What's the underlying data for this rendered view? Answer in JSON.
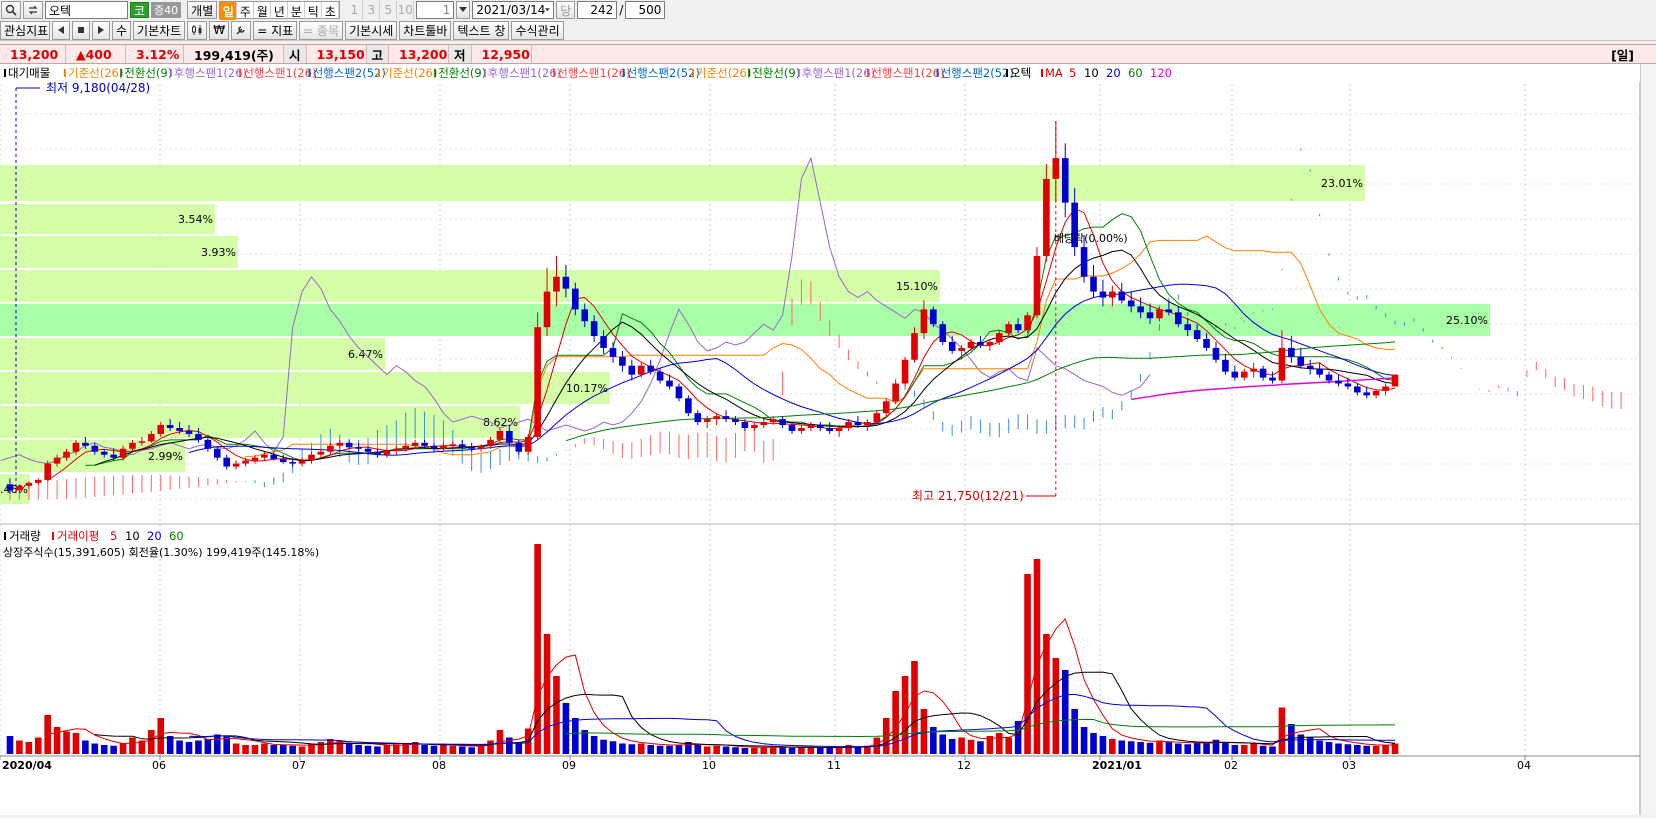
{
  "toolbar": {
    "stock_name": "오텍",
    "market_badge": "코",
    "margin_badge": "증40",
    "individual_label": "개별",
    "periods": [
      "일",
      "주",
      "월",
      "년",
      "분",
      "틱",
      "초"
    ],
    "active_period": "일",
    "interval_buttons": [
      "1",
      "3",
      "5",
      "10"
    ],
    "interval_value": "1",
    "date_value": "2021/03/14",
    "dang_label": "당",
    "count_value": "242",
    "slash": "/",
    "total_value": "500"
  },
  "toolbar2": {
    "watch_indicators": "관심지표",
    "basic_chart": "기본차트",
    "indicator": "= 지표",
    "stock_item": "= 종목",
    "basic_quote": "기본시세",
    "chart_toolbar": "차트툴바",
    "text_window": "텍스트 창",
    "formula_mgmt": "수식관리",
    "su": "수",
    "won_symbol": "₩"
  },
  "priceline": {
    "current": "13,200",
    "change": "▲400",
    "change_pct": "3.12%",
    "volume": "199,419(주)",
    "open_label": "시",
    "open": "13,150",
    "high_label": "고",
    "high": "13,200",
    "low_label": "저",
    "low": "12,950",
    "period_label": "[일]"
  },
  "legend": {
    "items": [
      {
        "text": "대기매물",
        "color": "#000000"
      },
      {
        "text": "기준선(26)",
        "color": "#ff8000"
      },
      {
        "text": "전환선(9)",
        "color": "#008000"
      },
      {
        "text": "후행스팬1(26)",
        "color": "#9966cc"
      },
      {
        "text": "선행스팬1(26)",
        "color": "#ff4040"
      },
      {
        "text": "선행스팬2(52)",
        "color": "#0066cc"
      },
      {
        "text": "기준선(26)",
        "color": "#ff8000"
      },
      {
        "text": "전환선(9)",
        "color": "#008000"
      },
      {
        "text": "후행스팬1(26)",
        "color": "#9966cc"
      },
      {
        "text": "선행스팬1(26)",
        "color": "#ff4040"
      },
      {
        "text": "선행스팬2(52)",
        "color": "#0066cc"
      },
      {
        "text": "기준선(26)",
        "color": "#ff8000"
      },
      {
        "text": "전환선(9)",
        "color": "#008000"
      },
      {
        "text": "후행스팬1(26)",
        "color": "#9966cc"
      },
      {
        "text": "선행스팬1(26)",
        "color": "#ff4040"
      },
      {
        "text": "선행스팬2(52)",
        "color": "#0066cc"
      },
      {
        "text": "오텍",
        "color": "#000000"
      }
    ],
    "ma_label": "MA",
    "ma_periods": [
      {
        "text": "5",
        "color": "#e00000"
      },
      {
        "text": "10",
        "color": "#000000"
      },
      {
        "text": "20",
        "color": "#0000e0"
      },
      {
        "text": "60",
        "color": "#008000"
      },
      {
        "text": "120",
        "color": "#e000e0"
      }
    ]
  },
  "volume_legend": {
    "title": "거래량",
    "ma_label": "거래이평",
    "periods": [
      {
        "text": "5",
        "color": "#e00000"
      },
      {
        "text": "10",
        "color": "#000000"
      },
      {
        "text": "20",
        "color": "#0000e0"
      },
      {
        "text": "60",
        "color": "#008000"
      }
    ],
    "shares_info": "상장주식수(15,391,605) 회전율(1.30%) 199,419주(145.18%)"
  },
  "chart_data": {
    "type": "candlestick",
    "x_tick_labels": [
      "2020/04",
      "06",
      "07",
      "08",
      "09",
      "10",
      "11",
      "12",
      "2021/01",
      "02",
      "03",
      "04"
    ],
    "annotations": {
      "low": "최저 9,180(04/28)",
      "high": "최고 21,750(12/21)",
      "ex_dividend": "배당락(0.00%)"
    },
    "supply_zones": [
      {
        "pct": "23.01%"
      },
      {
        "pct": "3.54%"
      },
      {
        "pct": "3.93%"
      },
      {
        "pct": "15.10%"
      },
      {
        "pct": "25.10%"
      },
      {
        "pct": "6.47%"
      },
      {
        "pct": "10.17%"
      },
      {
        "pct": "8.62%"
      },
      {
        "pct": "2.99%"
      },
      {
        "pct": "0.46%"
      }
    ],
    "candles": [
      [
        9500,
        9700,
        9180,
        9300
      ],
      [
        9300,
        9500,
        9200,
        9450
      ],
      [
        9450,
        9600,
        9350,
        9550
      ],
      [
        9550,
        9700,
        9500,
        9650
      ],
      [
        9650,
        10300,
        9600,
        10200
      ],
      [
        10200,
        10500,
        10100,
        10400
      ],
      [
        10400,
        10700,
        10300,
        10600
      ],
      [
        10600,
        11000,
        10500,
        10900
      ],
      [
        10900,
        11100,
        10700,
        10800
      ],
      [
        10800,
        10900,
        10500,
        10600
      ],
      [
        10600,
        10700,
        10400,
        10500
      ],
      [
        10500,
        10700,
        10300,
        10400
      ],
      [
        10400,
        10800,
        10300,
        10700
      ],
      [
        10700,
        11000,
        10600,
        10900
      ],
      [
        10900,
        11100,
        10800,
        10950
      ],
      [
        10950,
        11300,
        10900,
        11200
      ],
      [
        11200,
        11600,
        11100,
        11500
      ],
      [
        11500,
        11700,
        11300,
        11400
      ],
      [
        11400,
        11600,
        11200,
        11300
      ],
      [
        11300,
        11500,
        11100,
        11200
      ],
      [
        11200,
        11400,
        10900,
        11000
      ],
      [
        11000,
        11100,
        10600,
        10700
      ],
      [
        10700,
        10800,
        10300,
        10400
      ],
      [
        10400,
        10500,
        10000,
        10100
      ],
      [
        10100,
        10300,
        10000,
        10200
      ],
      [
        10200,
        10400,
        10100,
        10300
      ],
      [
        10300,
        10500,
        10200,
        10400
      ],
      [
        10400,
        10600,
        10300,
        10500
      ],
      [
        10500,
        10600,
        10300,
        10350
      ],
      [
        10350,
        10500,
        10200,
        10250
      ],
      [
        10250,
        10400,
        10100,
        10200
      ],
      [
        10200,
        10400,
        10100,
        10300
      ],
      [
        10300,
        10600,
        10200,
        10500
      ],
      [
        10500,
        10700,
        10400,
        10600
      ],
      [
        10600,
        10900,
        10500,
        10800
      ],
      [
        10800,
        11000,
        10700,
        10900
      ],
      [
        10900,
        11000,
        10700,
        10750
      ],
      [
        10750,
        10900,
        10600,
        10700
      ],
      [
        10700,
        10800,
        10500,
        10600
      ],
      [
        10600,
        10700,
        10400,
        10500
      ],
      [
        10500,
        10700,
        10400,
        10650
      ],
      [
        10650,
        10800,
        10500,
        10700
      ],
      [
        10700,
        10900,
        10600,
        10800
      ],
      [
        10800,
        11000,
        10700,
        10900
      ],
      [
        10900,
        11000,
        10700,
        10800
      ],
      [
        10800,
        10900,
        10600,
        10700
      ],
      [
        10700,
        10900,
        10600,
        10800
      ],
      [
        10800,
        10950,
        10700,
        10850
      ],
      [
        10850,
        11000,
        10700,
        10750
      ],
      [
        10750,
        10900,
        10600,
        10700
      ],
      [
        10700,
        10850,
        10600,
        10800
      ],
      [
        10800,
        11100,
        10700,
        11000
      ],
      [
        11000,
        11400,
        10900,
        11300
      ],
      [
        11300,
        11500,
        10800,
        10900
      ],
      [
        10900,
        11000,
        10500,
        10600
      ],
      [
        10600,
        11200,
        10500,
        11100
      ],
      [
        11100,
        15300,
        11000,
        14800
      ],
      [
        14800,
        16800,
        14500,
        16000
      ],
      [
        16000,
        17200,
        15500,
        16500
      ],
      [
        16500,
        16900,
        15800,
        16100
      ],
      [
        16100,
        16300,
        15200,
        15400
      ],
      [
        15400,
        15600,
        14800,
        15000
      ],
      [
        15000,
        15200,
        14300,
        14500
      ],
      [
        14500,
        14700,
        13900,
        14100
      ],
      [
        14100,
        14300,
        13600,
        13800
      ],
      [
        13800,
        14000,
        13300,
        13500
      ],
      [
        13500,
        13700,
        13000,
        13200
      ],
      [
        13200,
        13600,
        13100,
        13500
      ],
      [
        13500,
        13700,
        13200,
        13300
      ],
      [
        13300,
        13400,
        12900,
        13000
      ],
      [
        13000,
        13200,
        12700,
        12800
      ],
      [
        12800,
        12900,
        12300,
        12400
      ],
      [
        12400,
        12500,
        11800,
        11900
      ],
      [
        11900,
        12000,
        11500,
        11600
      ],
      [
        11600,
        11800,
        11400,
        11700
      ],
      [
        11700,
        11900,
        11500,
        11800
      ],
      [
        11800,
        12000,
        11600,
        11700
      ],
      [
        11700,
        11800,
        11500,
        11600
      ],
      [
        11600,
        11700,
        11300,
        11400
      ],
      [
        11400,
        11600,
        11300,
        11500
      ],
      [
        11500,
        11700,
        11400,
        11600
      ],
      [
        11600,
        11800,
        11500,
        11700
      ],
      [
        11700,
        11800,
        11400,
        11500
      ],
      [
        11500,
        11600,
        11200,
        11300
      ],
      [
        11300,
        11500,
        11200,
        11400
      ],
      [
        11400,
        11600,
        11300,
        11500
      ],
      [
        11500,
        11600,
        11300,
        11400
      ],
      [
        11400,
        11600,
        11200,
        11300
      ],
      [
        11300,
        11500,
        11100,
        11400
      ],
      [
        11400,
        11700,
        11300,
        11600
      ],
      [
        11600,
        11800,
        11400,
        11500
      ],
      [
        11500,
        11700,
        11300,
        11600
      ],
      [
        11600,
        12000,
        11500,
        11900
      ],
      [
        11900,
        12400,
        11800,
        12300
      ],
      [
        12300,
        13000,
        12200,
        12900
      ],
      [
        12900,
        13800,
        12800,
        13700
      ],
      [
        13700,
        14800,
        13600,
        14600
      ],
      [
        14600,
        15700,
        14400,
        15400
      ],
      [
        15400,
        15500,
        14800,
        14900
      ],
      [
        14900,
        15000,
        14200,
        14300
      ],
      [
        14300,
        14500,
        13900,
        14000
      ],
      [
        14000,
        14200,
        13700,
        14100
      ],
      [
        14100,
        14400,
        14000,
        14300
      ],
      [
        14300,
        14500,
        14100,
        14200
      ],
      [
        14200,
        14400,
        14000,
        14300
      ],
      [
        14300,
        14700,
        14200,
        14600
      ],
      [
        14600,
        15000,
        14500,
        14900
      ],
      [
        14900,
        15100,
        14600,
        14700
      ],
      [
        14700,
        15300,
        14600,
        15200
      ],
      [
        15200,
        17500,
        15100,
        17200
      ],
      [
        17200,
        20300,
        17000,
        19800
      ],
      [
        19800,
        21750,
        19000,
        20500
      ],
      [
        20500,
        21000,
        18500,
        19000
      ],
      [
        19000,
        19500,
        17200,
        17500
      ],
      [
        17500,
        17900,
        16300,
        16500
      ],
      [
        16500,
        16900,
        15800,
        16000
      ],
      [
        16000,
        16400,
        15500,
        15800
      ],
      [
        15800,
        16200,
        15500,
        16000
      ],
      [
        16000,
        16300,
        15600,
        15700
      ],
      [
        15700,
        16000,
        15300,
        15500
      ],
      [
        15500,
        15800,
        15100,
        15300
      ],
      [
        15300,
        15600,
        14900,
        15100
      ],
      [
        15100,
        15500,
        15000,
        15400
      ],
      [
        15400,
        15700,
        15200,
        15300
      ],
      [
        15300,
        15500,
        14800,
        14900
      ],
      [
        14900,
        15100,
        14500,
        14700
      ],
      [
        14700,
        14900,
        14300,
        14400
      ],
      [
        14400,
        14600,
        14000,
        14100
      ],
      [
        14100,
        14300,
        13600,
        13700
      ],
      [
        13700,
        13900,
        13200,
        13300
      ],
      [
        13300,
        13500,
        13000,
        13100
      ],
      [
        13100,
        13400,
        13000,
        13300
      ],
      [
        13300,
        13600,
        13100,
        13400
      ],
      [
        13400,
        13500,
        13000,
        13100
      ],
      [
        13100,
        13300,
        12900,
        13000
      ],
      [
        13000,
        14700,
        12900,
        14100
      ],
      [
        14100,
        14500,
        13600,
        13800
      ],
      [
        13800,
        14100,
        13400,
        13500
      ],
      [
        13500,
        13700,
        13200,
        13400
      ],
      [
        13400,
        13600,
        13100,
        13200
      ],
      [
        13200,
        13300,
        12900,
        13000
      ],
      [
        13000,
        13200,
        12800,
        12900
      ],
      [
        12900,
        13100,
        12700,
        12800
      ],
      [
        12800,
        12900,
        12500,
        12600
      ],
      [
        12600,
        12800,
        12400,
        12500
      ],
      [
        12500,
        12700,
        12400,
        12650
      ],
      [
        12650,
        12900,
        12500,
        12800
      ],
      [
        12800,
        13200,
        12950,
        13200
      ]
    ],
    "volumes": [
      120,
      90,
      80,
      110,
      260,
      180,
      150,
      140,
      90,
      70,
      60,
      55,
      70,
      110,
      90,
      160,
      240,
      120,
      90,
      80,
      90,
      100,
      130,
      120,
      70,
      60,
      60,
      70,
      60,
      60,
      55,
      50,
      70,
      80,
      100,
      90,
      70,
      60,
      55,
      50,
      60,
      65,
      70,
      80,
      60,
      55,
      60,
      55,
      50,
      45,
      55,
      90,
      160,
      110,
      80,
      170,
      1400,
      800,
      520,
      340,
      240,
      160,
      120,
      95,
      85,
      70,
      65,
      70,
      60,
      55,
      55,
      60,
      80,
      65,
      50,
      55,
      50,
      45,
      40,
      42,
      45,
      50,
      45,
      40,
      45,
      45,
      40,
      40,
      45,
      60,
      50,
      55,
      110,
      240,
      420,
      520,
      620,
      300,
      180,
      130,
      100,
      110,
      95,
      85,
      120,
      140,
      110,
      220,
      1200,
      1300,
      800,
      640,
      560,
      300,
      180,
      140,
      120,
      100,
      90,
      85,
      80,
      75,
      90,
      80,
      70,
      65,
      75,
      70,
      95,
      80,
      60,
      60,
      70,
      55,
      50,
      310,
      200,
      130,
      110,
      90,
      80,
      70,
      65,
      60,
      55,
      55,
      60,
      70
    ],
    "ma": {
      "periods": [
        5,
        10,
        20,
        60,
        120
      ]
    },
    "price_range": [
      8500,
      23000
    ]
  }
}
